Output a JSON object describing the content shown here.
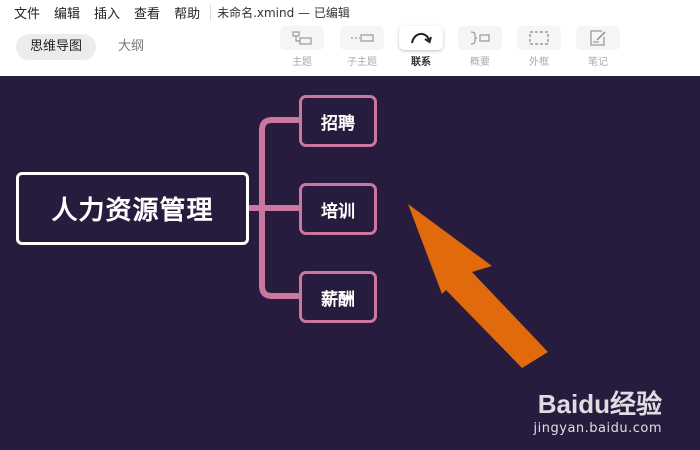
{
  "menu": {
    "items": [
      "文件",
      "编辑",
      "插入",
      "查看",
      "帮助"
    ],
    "document_title": "未命名.xmind — 已编辑"
  },
  "view_tabs": [
    {
      "label": "思维导图",
      "active": true
    },
    {
      "label": "大纲",
      "active": false
    }
  ],
  "toolbar": {
    "tools": [
      {
        "label": "主题",
        "icon": "topic-icon",
        "active": false
      },
      {
        "label": "子主题",
        "icon": "subtopic-icon",
        "active": false
      },
      {
        "label": "联系",
        "icon": "relationship-icon",
        "active": true
      },
      {
        "label": "概要",
        "icon": "summary-icon",
        "active": false
      },
      {
        "label": "外框",
        "icon": "boundary-icon",
        "active": false
      },
      {
        "label": "笔记",
        "icon": "note-icon",
        "active": false
      }
    ]
  },
  "mindmap": {
    "root": "人力资源管理",
    "children": [
      "招聘",
      "培训",
      "薪酬"
    ],
    "colors": {
      "background": "#271c3d",
      "root_border": "#ffffff",
      "branch": "#c9779f",
      "arrow": "#e06a0c"
    }
  },
  "watermark": {
    "brand": "Baidu经验",
    "url": "jingyan.baidu.com"
  }
}
